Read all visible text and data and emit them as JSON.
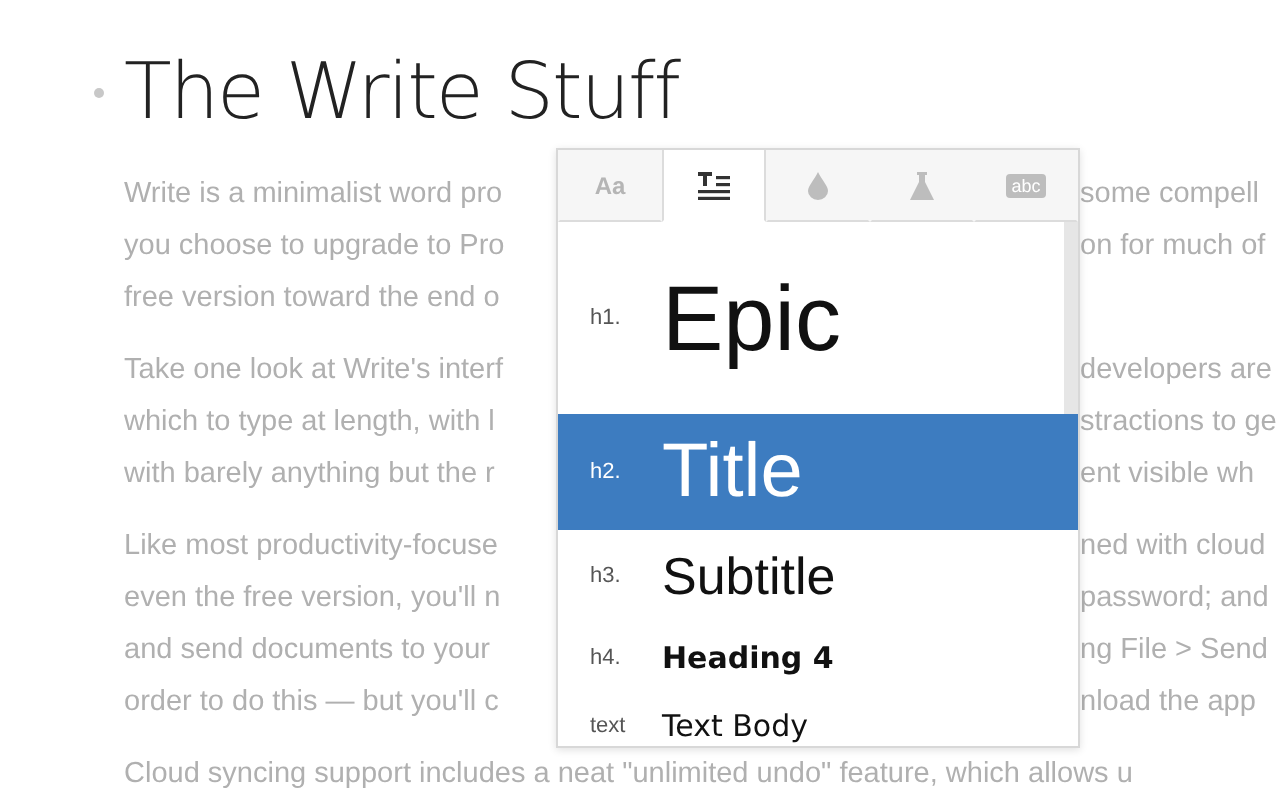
{
  "document": {
    "title": "The Write Stuff",
    "paragraphs": [
      {
        "lines": [
          {
            "left": "Write is a minimalist word pro",
            "right": "some compell"
          },
          {
            "left": "you choose to upgrade to Pro",
            "right": "on for much of"
          },
          {
            "left": "free version toward the end o"
          }
        ]
      },
      {
        "lines": [
          {
            "left": "Take one look at Write's interf",
            "right": "developers are"
          },
          {
            "left": "which to type at length, with l",
            "right": "stractions to ge"
          },
          {
            "left": "with barely anything but the r",
            "right": "ent visible wh"
          }
        ]
      },
      {
        "lines": [
          {
            "left": "Like most productivity-focuse",
            "right": "ned with cloud"
          },
          {
            "left": "even the free version, you'll n",
            "right": "password; and"
          },
          {
            "left": "and send documents to your",
            "right": "ng File > Send"
          },
          {
            "left": "order to do this — but you'll c",
            "right": "nload the app"
          }
        ]
      },
      {
        "lines": [
          {
            "left": "Cloud syncing support includes a neat \"unlimited undo\" feature, which allows u"
          }
        ]
      }
    ]
  },
  "style_popup": {
    "tabs": [
      {
        "kind": "text",
        "label": "Aa",
        "selected": false
      },
      {
        "kind": "heading",
        "selected": true
      },
      {
        "kind": "drop",
        "selected": false
      },
      {
        "kind": "flask",
        "selected": false
      },
      {
        "kind": "badge",
        "label": "abc",
        "selected": false
      }
    ],
    "styles": [
      {
        "kind": "h1",
        "tag": "h1.",
        "name": "Epic",
        "selected": false
      },
      {
        "kind": "h2",
        "tag": "h2.",
        "name": "Title",
        "selected": true
      },
      {
        "kind": "h3",
        "tag": "h3.",
        "name": "Subtitle",
        "selected": false
      },
      {
        "kind": "h4",
        "tag": "h4.",
        "name": "Heading 4",
        "selected": false
      },
      {
        "kind": "text",
        "tag": "text",
        "name": "Text Body",
        "selected": false
      }
    ]
  }
}
